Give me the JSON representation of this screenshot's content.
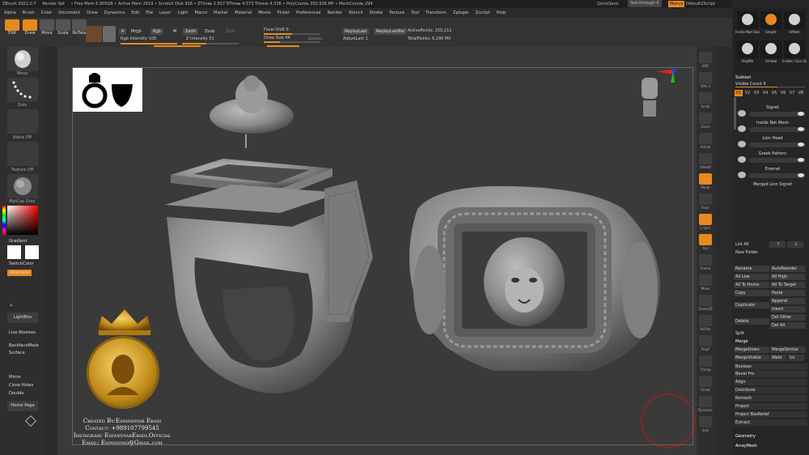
{
  "titlebar": {
    "app": "ZBrush 2022.0.7",
    "render_set": "Render Set",
    "stats": "• Free Mem 6.905GB • Active Mem 2619 • Scratch Disk 916 • ZTime▸ 2.657 RTime▸ 4.573 Timer▸ 4.336 • PolyCount▸ 350.928 MP • MeshCount▸ 294",
    "quicksave": "QuickSave",
    "seethrough": "See-through  0",
    "menus": "Menus",
    "script": "Default2Script"
  },
  "menubar": [
    "Alpha",
    "Brush",
    "Color",
    "Document",
    "Draw",
    "Dynamics",
    "Edit",
    "File",
    "Layer",
    "Light",
    "Macro",
    "Marker",
    "Material",
    "Movie",
    "Picker",
    "Preferences",
    "Render",
    "Stencil",
    "Stroke",
    "Texture",
    "Tool",
    "Transform",
    "Zplugin",
    "Zscript",
    "Help"
  ],
  "toolbar": {
    "edit": "Edit",
    "draw": "Draw",
    "move": "Move",
    "scale": "Scale",
    "rotate": "RoTate",
    "a": "A",
    "mrgb": "Mrgb",
    "rgb": "Rgb",
    "m": "M",
    "rgb_intensity": "Rgb Intensity 100",
    "zadd": "Zadd",
    "zsub": "Zsub",
    "zcut": "Zcut",
    "z_intensity": "Z Intensity 51",
    "focal_shift": "Focal Shift 0",
    "draw_size": "Draw Size 44",
    "dynamic": "Dynamic",
    "replay_last": "ReplayLast",
    "replay_last_rel": "ReplayLastRel",
    "adjust_last": "AdjustLast 1",
    "active_points": "ActivePoints: 250,211",
    "total_points": "TotalPoints: 6.290 Mil"
  },
  "leftshelf": {
    "move": "Move",
    "dots": "Dots",
    "alpha_off": "Alpha Off",
    "texture_off": "Texture Off",
    "matcap": "MatCap Gray",
    "gradient": "Gradient",
    "switch_color": "SwitchColor",
    "alternate": "Alternate",
    "lightbox": "LightBox",
    "live_boolean": "Live Boolean",
    "backface_mask": "BackfaceMask",
    "surface": "Surface",
    "mirror": "Mirror",
    "close_holes": "Close Holes",
    "double": "Double",
    "home_page": "Home Page"
  },
  "rightshelf": [
    "BPR",
    "SPix 3",
    "Scroll",
    "Zoom",
    "Actual",
    "AAHalf",
    "Persp",
    "Floor",
    "L.Sym",
    "Xyz",
    "Frame",
    "Move",
    "Zoom3D",
    "RoTate",
    "PolyF",
    "Transp",
    "Ghost",
    "Dynamic",
    "Solo"
  ],
  "trays": {
    "top_brushes": [
      "Inside Nwt Skis",
      "Smplst",
      "UMesh",
      "PolyMe",
      "Gimbal",
      "Inside / Lion Sig"
    ],
    "subtool_title": "Subtool",
    "visible_count": "Visible Count 9",
    "vtabs": [
      "V1",
      "V2",
      "V3",
      "V4",
      "V5",
      "V6",
      "V7",
      "V8"
    ],
    "subtools": [
      "Signet",
      "Inside Net Mesh",
      "Lion Head",
      "Greek Pattern",
      "Enamel",
      "Merged Lion Signet"
    ],
    "list_all": "List All",
    "new_folder": "New Folder",
    "rename": "Rename",
    "auto_reorder": "AutoReorder",
    "all_low": "All Low",
    "all_high": "All High",
    "all_to_home": "All To Home",
    "all_to_target": "All To Target",
    "copy": "Copy",
    "paste": "Paste",
    "append": "Append",
    "duplicate": "Duplicate",
    "insert": "Insert",
    "delete": "Delete",
    "del_other": "Del Other",
    "del_all": "Del All",
    "split": "Split",
    "merge": "Merge",
    "merge_down": "MergeDown",
    "merge_similar": "MergeSimilar",
    "merge_visible": "MergeVisible",
    "weld": "Weld",
    "uv": "Uv",
    "boolean": "Boolean",
    "bevel_pro": "Bevel Pro",
    "align": "Align",
    "distribute": "Distribute",
    "remesh": "Remesh",
    "project": "Project",
    "project_bas_relief": "Project BasRelief",
    "extract": "Extract",
    "geometry": "Geometry",
    "array_mesh": "ArrayMesh"
  },
  "credits": {
    "created_by": "Created By:Esfandiyar Ebadi",
    "contact": "Contact: +989107799545",
    "instagram": "Instagram: EsfandyarEbadi.Official",
    "email": "Email: Espandyad@Gmail.com"
  },
  "colors": {
    "accent": "#e8891e",
    "background": "#3a3a3a",
    "gold": "#d4a017"
  }
}
